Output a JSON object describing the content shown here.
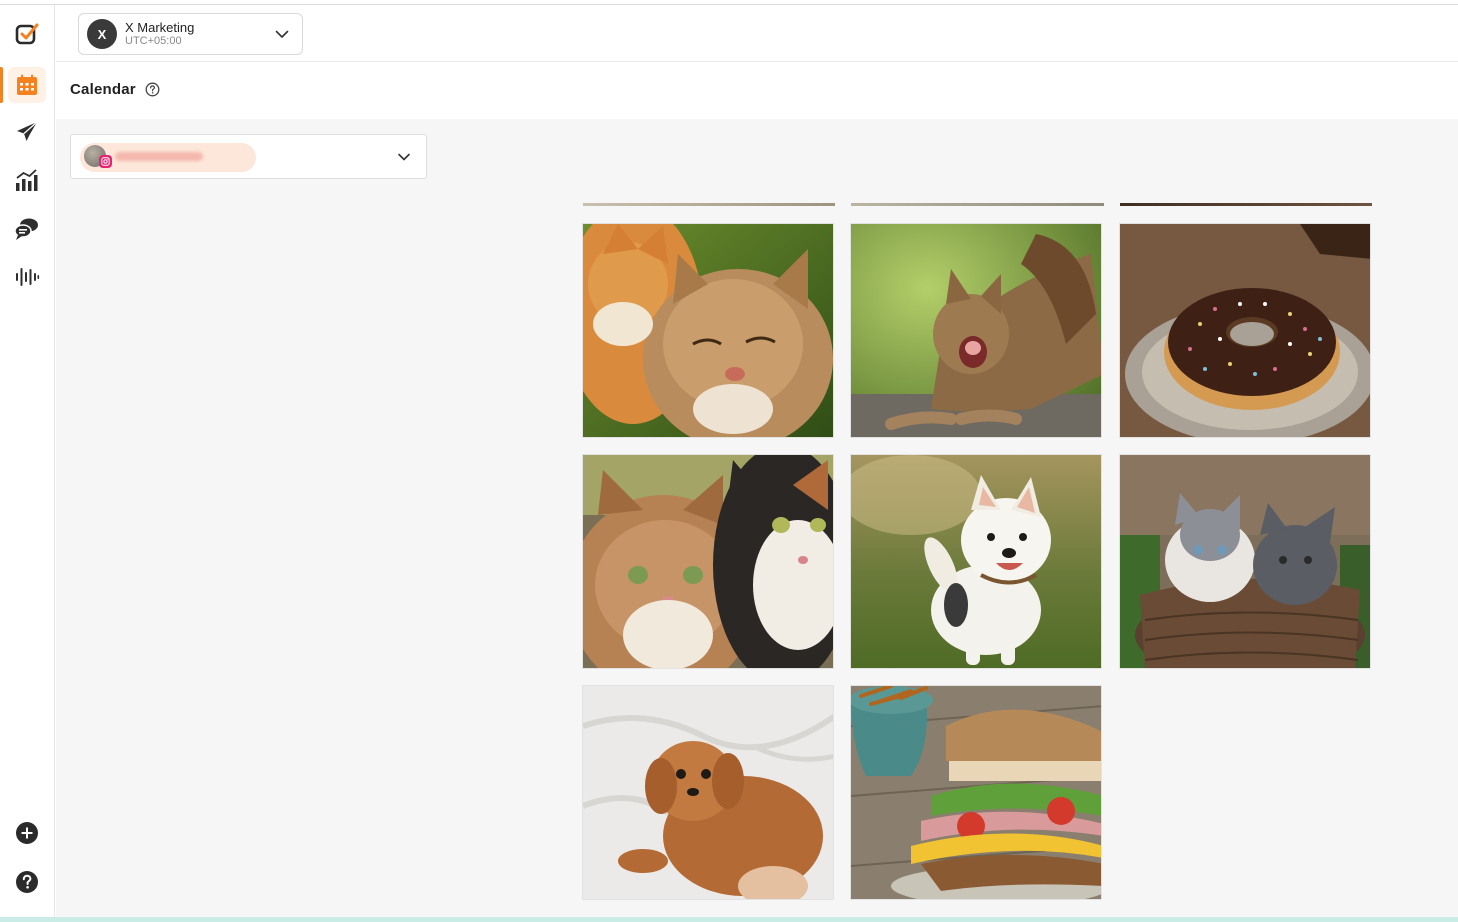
{
  "workspace": {
    "initial": "X",
    "name": "X Marketing",
    "timezone": "UTC+05:00"
  },
  "page": {
    "title": "Calendar"
  },
  "sidebar": {
    "items": [
      {
        "name": "logo",
        "icon": "brand-check-icon"
      },
      {
        "name": "calendar",
        "icon": "calendar-icon",
        "active": true
      },
      {
        "name": "publish",
        "icon": "paper-plane-icon"
      },
      {
        "name": "analytics",
        "icon": "bar-chart-icon"
      },
      {
        "name": "engage",
        "icon": "chat-bubbles-icon"
      },
      {
        "name": "listening",
        "icon": "sound-wave-icon"
      }
    ],
    "bottom": [
      {
        "name": "add",
        "icon": "plus-circle-icon"
      },
      {
        "name": "help",
        "icon": "question-circle-icon"
      }
    ]
  },
  "account_selector": {
    "network": "instagram",
    "icon": "instagram-icon"
  },
  "media_grid": {
    "items": [
      {
        "name": "two-cats"
      },
      {
        "name": "yawning-cat"
      },
      {
        "name": "chocolate-donut"
      },
      {
        "name": "tabby-and-calico-cats"
      },
      {
        "name": "happy-white-puppy"
      },
      {
        "name": "kittens-in-basket"
      },
      {
        "name": "fluffy-brown-puppy"
      },
      {
        "name": "sandwich"
      }
    ]
  },
  "colors": {
    "accent": "#f58220",
    "instagram": "#e6246f",
    "background": "#f6f6f6"
  }
}
